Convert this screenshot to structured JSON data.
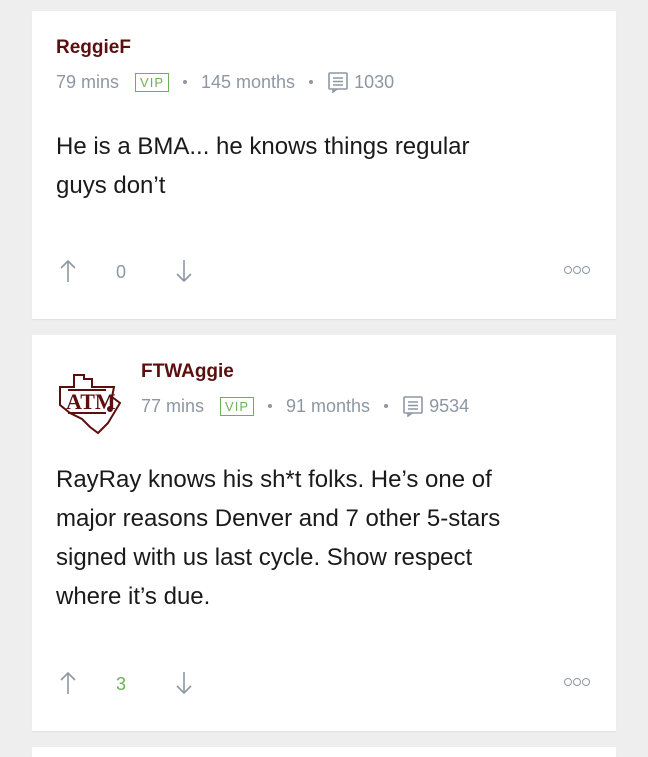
{
  "comments": [
    {
      "username": "ReggieF",
      "time": "79 mins",
      "badge": "VIP",
      "tenure": "145 months",
      "post_count": "1030",
      "body_lines": [
        "He is a BMA... he knows things regular",
        "guys don’t"
      ],
      "votes": "0",
      "avatar_text": ""
    },
    {
      "username": "FTWAggie",
      "time": "77 mins",
      "badge": "VIP",
      "tenure": "91 months",
      "post_count": "9534",
      "body_lines": [
        "RayRay knows his sh*t folks. He’s one of",
        "major reasons Denver and 7 other 5-stars",
        "signed with us last cycle. Show respect",
        "where it’s due."
      ],
      "votes": "3",
      "avatar_text": "ATM"
    }
  ],
  "colors": {
    "username": "#5b0f0f",
    "meta": "#8d97a3",
    "vip": "#6bb257",
    "positive_votes": "#6bb257",
    "background": "#eeeeee",
    "card": "#ffffff"
  },
  "icons": {
    "post_count": "posts-icon",
    "upvote": "arrow-up-icon",
    "downvote": "arrow-down-icon",
    "more": "more-options-icon"
  }
}
